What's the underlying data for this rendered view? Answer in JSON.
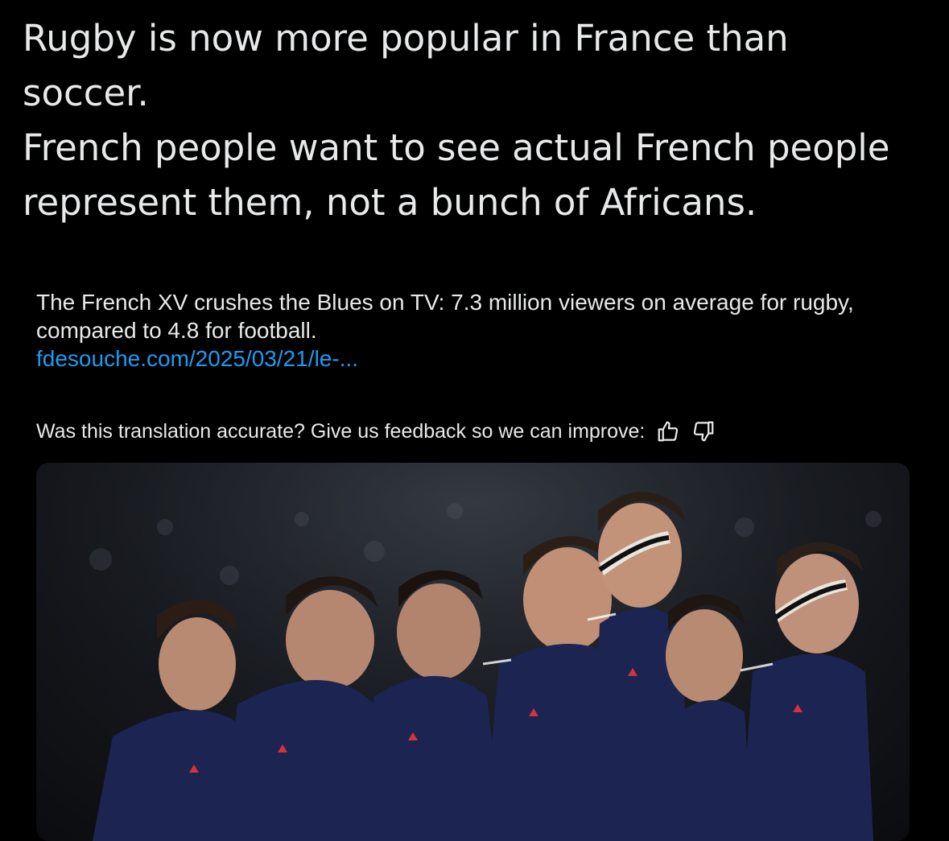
{
  "post": {
    "lines": [
      "Rugby is now more popular in France than soccer.",
      "French people want to see actual French people represent them, not a bunch of Africans."
    ]
  },
  "quote": {
    "text": "The French XV crushes the Blues on TV: 7.3 million viewers on average for rugby, compared to 4.8 for football.",
    "link": "fdesouche.com/2025/03/21/le-..."
  },
  "feedback": {
    "prompt": "Was this translation accurate? Give us feedback so we can improve:",
    "thumbs_up_icon": "thumbs-up-icon",
    "thumbs_down_icon": "thumbs-down-icon"
  },
  "media": {
    "description_icon": "photo"
  },
  "colors": {
    "background": "#000000",
    "text": "#e7e9ea",
    "link": "#1d9bf0",
    "jersey": "#1c2452"
  }
}
